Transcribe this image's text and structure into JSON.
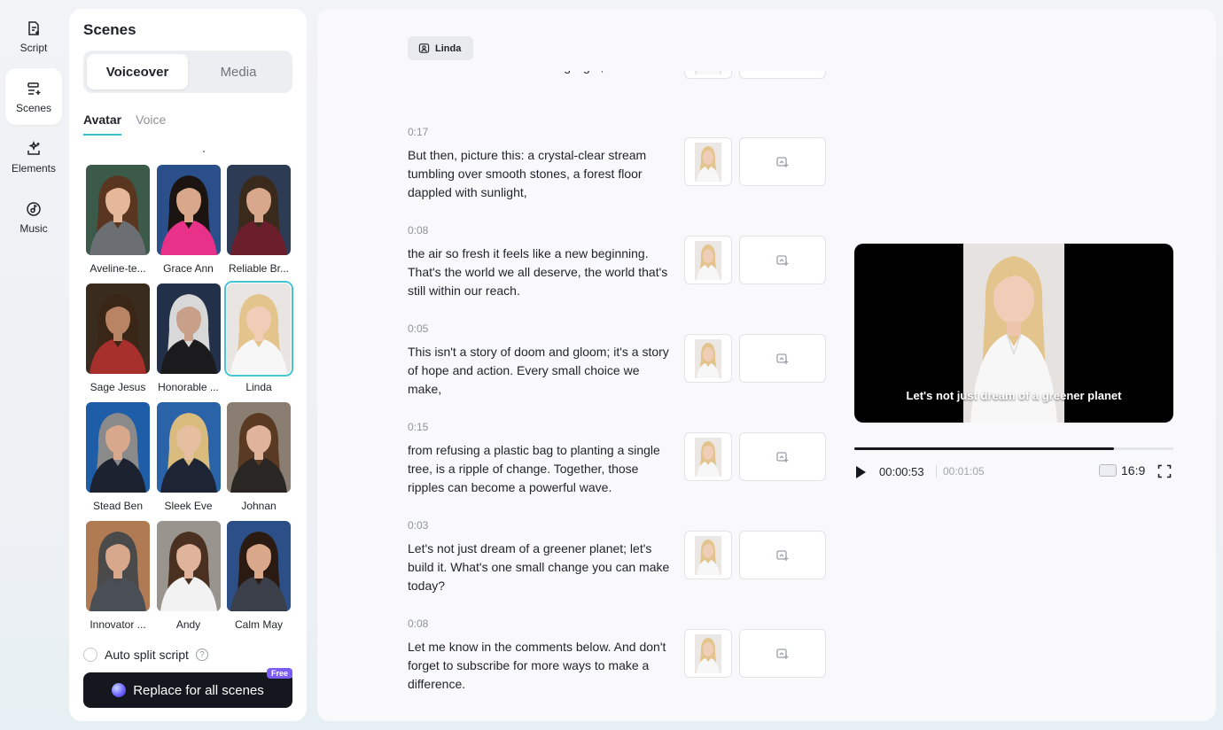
{
  "rail": {
    "items": [
      {
        "label": "Script",
        "icon": "script-icon"
      },
      {
        "label": "Scenes",
        "icon": "scenes-icon"
      },
      {
        "label": "Elements",
        "icon": "elements-icon"
      },
      {
        "label": "Music",
        "icon": "music-icon"
      }
    ],
    "active": "Scenes"
  },
  "panel": {
    "title": "Scenes",
    "segment": {
      "voiceover": "Voiceover",
      "media": "Media",
      "active": "Voiceover"
    },
    "subtabs": {
      "avatar": "Avatar",
      "voice": "Voice",
      "active": "Avatar"
    },
    "avatars": [
      {
        "name": "Aveline-te...",
        "bg": "#3b5a4a",
        "skin": "#e5b89a",
        "hair": "#5a3520",
        "shirt": "#6b6f74"
      },
      {
        "name": "Grace Ann",
        "bg": "#2a4f8a",
        "skin": "#d9a88a",
        "hair": "#1c1410",
        "shirt": "#e8328a"
      },
      {
        "name": "Reliable Br...",
        "bg": "#2d3b55",
        "skin": "#d8a88d",
        "hair": "#3a2a1c",
        "shirt": "#6b1f2c"
      },
      {
        "name": "Sage Jesus",
        "bg": "#3a2b1f",
        "skin": "#b88464",
        "hair": "#3a2616",
        "shirt": "#a8302c"
      },
      {
        "name": "Honorable ...",
        "bg": "#223049",
        "skin": "#c8a08a",
        "hair": "#d8d8d8",
        "shirt": "#1b1b1e"
      },
      {
        "name": "Linda",
        "bg": "#e9e5e2",
        "skin": "#f0cdb6",
        "hair": "#e2c48c",
        "shirt": "#f7f7f7"
      },
      {
        "name": "Stead Ben",
        "bg": "#1e5ea8",
        "skin": "#d8a88d",
        "hair": "#8a8a8a",
        "shirt": "#1c2230"
      },
      {
        "name": "Sleek Eve",
        "bg": "#2a63a8",
        "skin": "#e6bea0",
        "hair": "#d9bb7e",
        "shirt": "#1d2535"
      },
      {
        "name": "Johnan",
        "bg": "#8a7d72",
        "skin": "#e0b49a",
        "hair": "#5a3a22",
        "shirt": "#2a2624"
      },
      {
        "name": "Innovator ...",
        "bg": "#b07a52",
        "skin": "#d8a88d",
        "hair": "#4a4a4a",
        "shirt": "#4a4e55"
      },
      {
        "name": "Andy",
        "bg": "#9a948e",
        "skin": "#e0b49a",
        "hair": "#4a3020",
        "shirt": "#f2f2f2"
      },
      {
        "name": "Calm May",
        "bg": "#2b4f86",
        "skin": "#d9a88a",
        "hair": "#2a1a12",
        "shirt": "#3a3f4a"
      }
    ],
    "selected_avatar": "Linda",
    "auto_split_label": "Auto split script",
    "help_icon": "question-icon",
    "replace_button": "Replace for all scenes",
    "free_badge": "Free"
  },
  "main": {
    "chip_label": "Linda",
    "scenes": [
      {
        "time": "",
        "text": "of a city, city so thick with smog you can't see the stars? It's a heartbreaking sight, isn't it?"
      },
      {
        "time": "0:17",
        "text": "But then, picture this: a crystal-clear stream tumbling over smooth stones, a forest floor dappled with sunlight,"
      },
      {
        "time": "0:08",
        "text": "the air so fresh it feels like a new beginning. That's the world we all deserve, the world that's still within our reach."
      },
      {
        "time": "0:05",
        "text": "This isn't a story of doom and gloom; it's a story of hope and action. Every small choice we make,"
      },
      {
        "time": "0:15",
        "text": "from refusing a plastic bag to planting a single tree, is a ripple of change. Together, those ripples can become a powerful wave."
      },
      {
        "time": "0:03",
        "text": "Let's not just dream of a greener planet; let's build it. What's one small change you can make today?"
      },
      {
        "time": "0:08",
        "text": "Let me know in the comments below. And don't forget to subscribe for more ways to make a difference."
      }
    ]
  },
  "player": {
    "caption": "Let's not just dream of a greener planet",
    "current_time": "00:00:53",
    "total_time": "00:01:05",
    "progress_fraction": 0.815,
    "aspect_ratio": "16:9"
  }
}
